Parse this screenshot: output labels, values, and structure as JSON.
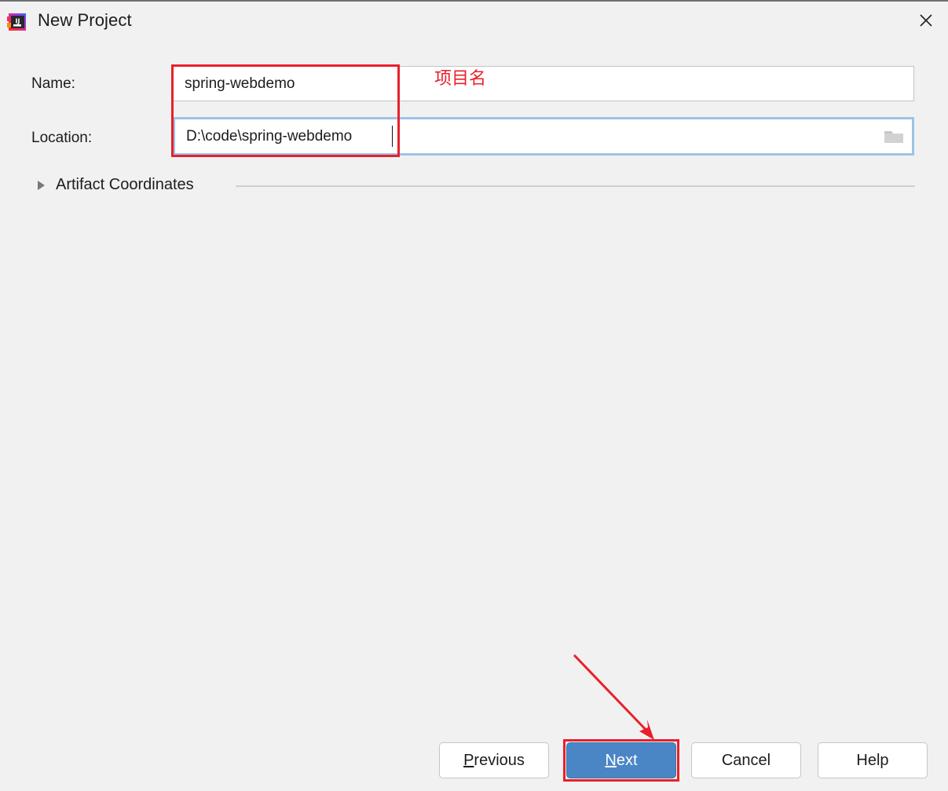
{
  "window": {
    "title": "New Project",
    "app_icon": "intellij-idea-icon",
    "close_icon": "close-icon",
    "background_color": "#f1f1f1"
  },
  "form": {
    "name": {
      "label": "Name:",
      "value": "spring-webdemo",
      "placeholder": ""
    },
    "location": {
      "label": "Location:",
      "value": "D:\\code\\spring-webdemo",
      "placeholder": "",
      "browse_icon": "folder-icon",
      "focused": true
    },
    "artifact_coordinates": {
      "label": "Artifact Coordinates",
      "expanded": false,
      "expander_icon": "chevron-right-icon"
    }
  },
  "annotations": {
    "fields_note": "项目名",
    "color": "#e8202a",
    "arrow": "arrow-pointing-to-next-button",
    "boxed_targets": [
      "name-and-location-fields",
      "next-button"
    ]
  },
  "buttons": {
    "previous": {
      "label": "Previous",
      "mnemonic": "P",
      "rest": "revious"
    },
    "next": {
      "label": "Next",
      "mnemonic": "N",
      "rest": "ext",
      "primary": true,
      "accent_color": "#4a86c5"
    },
    "cancel": {
      "label": "Cancel"
    },
    "help": {
      "label": "Help"
    }
  }
}
